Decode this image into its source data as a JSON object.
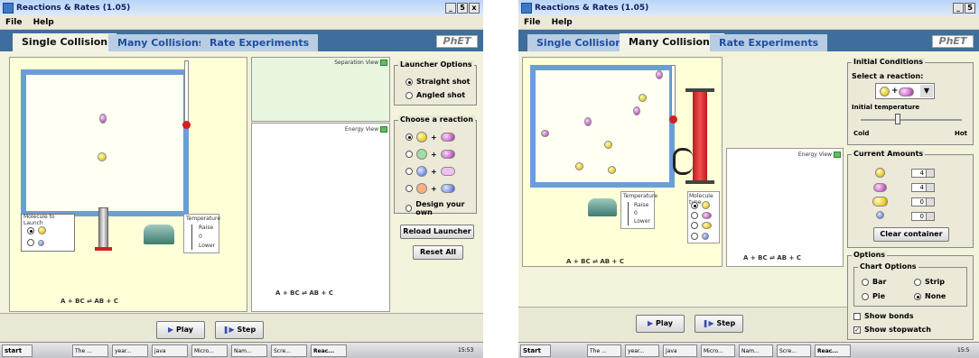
{
  "left": {
    "title": "Reactions & Rates (1.05)",
    "win_btns": [
      "_",
      "5",
      "x"
    ],
    "menu": [
      "File",
      "Help"
    ],
    "tabs": [
      "Single Collision",
      "Many Collisions",
      "Rate Experiments"
    ],
    "phet": "PhET",
    "separation_view": "Separation View",
    "energy_view": "Energy View",
    "launcher_options": {
      "title": "Launcher Options",
      "options": [
        "Straight shot",
        "Angled shot"
      ],
      "selected": 0
    },
    "choose_reaction": {
      "title": "Choose a reaction",
      "custom": "Design your own",
      "selected": 0
    },
    "molecule_launch": {
      "title": "Molecule to Launch"
    },
    "temperature": {
      "title": "Temperature",
      "raise": "Raise",
      "zero": "0",
      "lower": "Lower"
    },
    "reload_launcher": "Reload Launcher",
    "reset_all": "Reset All",
    "play": "Play",
    "step": "Step",
    "equation": "A + BC ⇌ AB + C"
  },
  "right": {
    "title": "Reactions & Rates (1.05)",
    "win_btns": [
      "_",
      "5"
    ],
    "menu": [
      "File",
      "Help"
    ],
    "tabs": [
      "Single Collision",
      "Many Collisions",
      "Rate Experiments"
    ],
    "phet": "PhET",
    "initial_conditions": {
      "title": "Initial Conditions",
      "select_reaction": "Select a reaction:",
      "initial_temperature": "Initial temperature",
      "cold": "Cold",
      "hot": "Hot"
    },
    "current_amounts": {
      "title": "Current Amounts",
      "values": [
        "4",
        "4",
        "0",
        "0"
      ],
      "clear": "Clear container"
    },
    "options": {
      "title": "Options",
      "chart_options": "Chart Options",
      "chart_choices": [
        "Bar",
        "Strip",
        "Pie",
        "None"
      ],
      "chart_selected": "None",
      "show_bonds": "Show bonds",
      "show_stopwatch": "Show stopwatch",
      "show_bonds_checked": false,
      "show_stopwatch_checked": true
    },
    "molecule_type": "Molecule type",
    "temperature": {
      "title": "Temperature",
      "raise": "Raise",
      "zero": "0",
      "lower": "Lower"
    },
    "energy_view": "Energy View",
    "play": "Play",
    "step": "Step",
    "equation": "A + BC ⇌ AB + C"
  },
  "taskbar_left": {
    "start": "start",
    "items": [
      "The ...",
      "year...",
      "java",
      "Micro...",
      "Nam...",
      "Scre...",
      "Reac..."
    ],
    "clock": "15:53"
  },
  "taskbar_right": {
    "start": "Start",
    "items": [
      "The ...",
      "year...",
      "java",
      "Micro...",
      "Nam...",
      "Scre...",
      "Reac..."
    ],
    "clock": "15:5"
  },
  "colors": {
    "tabbar": "#3e6f9c",
    "container_border": "#6a9ed8",
    "molecule_a": "#e8c820",
    "molecule_bc": "#c060c0"
  }
}
